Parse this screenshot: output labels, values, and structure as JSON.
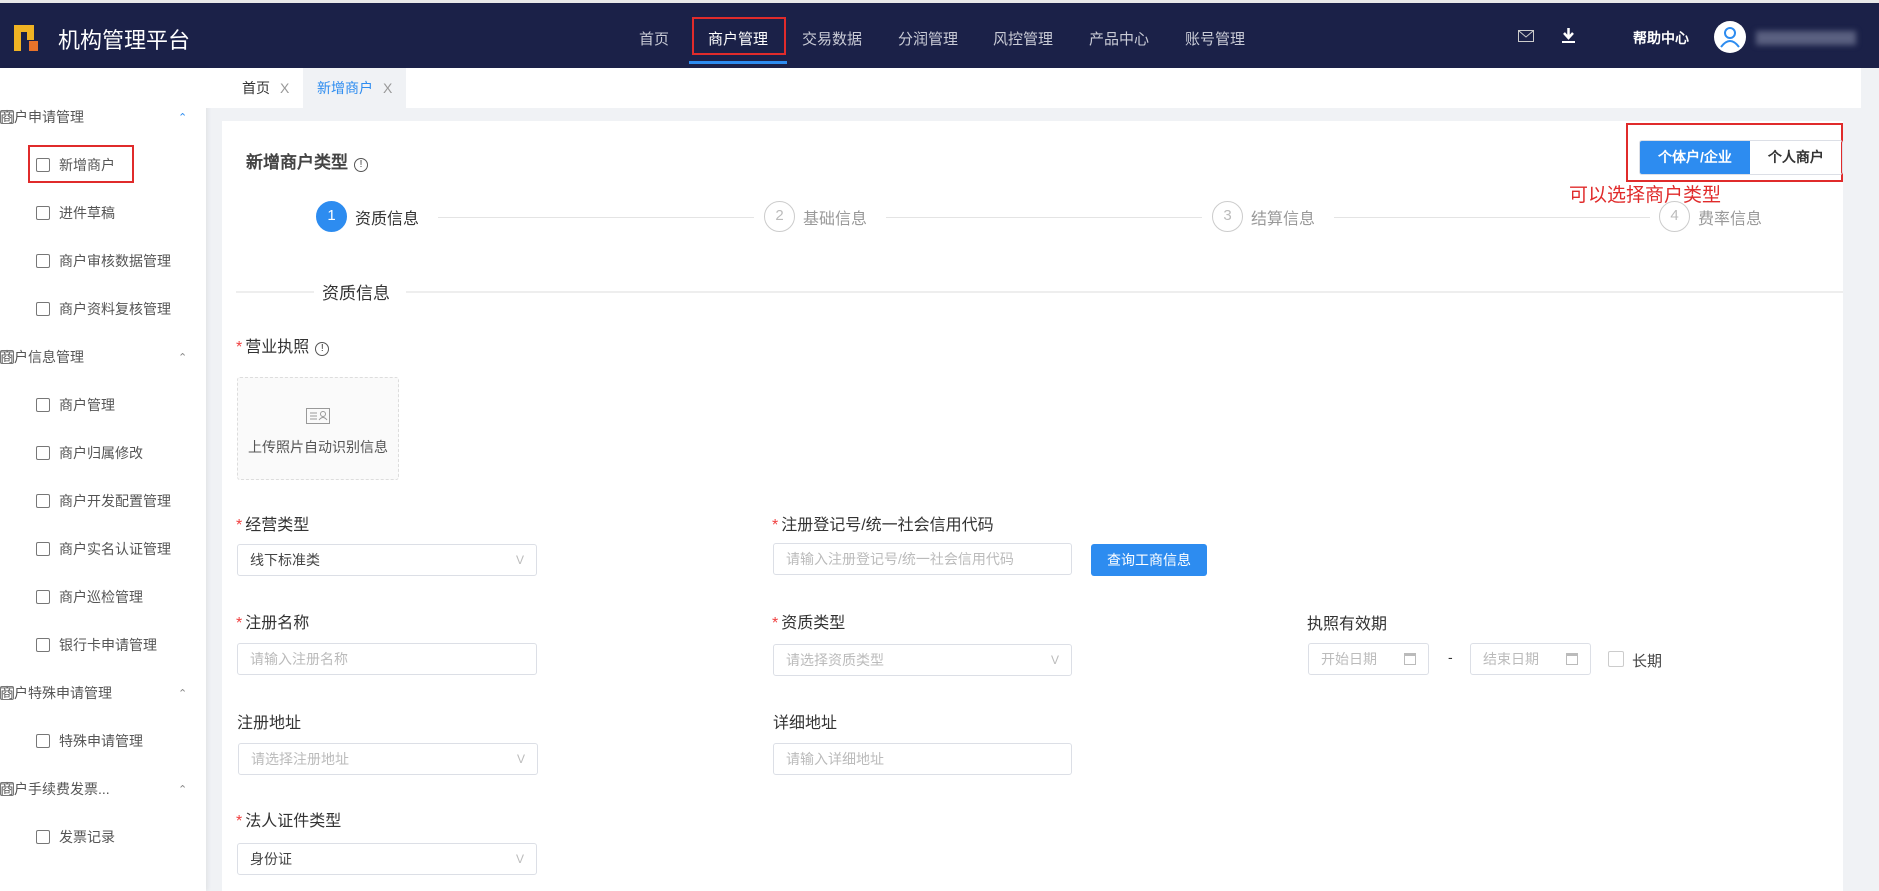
{
  "header": {
    "brand": "机构管理平台",
    "nav": [
      "首页",
      "商户管理",
      "交易数据",
      "分润管理",
      "风控管理",
      "产品中心",
      "账号管理"
    ],
    "active_nav": "商户管理",
    "help": "帮助中心"
  },
  "sidebar": {
    "items": [
      {
        "label": "商户申请管理",
        "type": "group"
      },
      {
        "label": "新增商户",
        "type": "sub"
      },
      {
        "label": "进件草稿",
        "type": "sub"
      },
      {
        "label": "商户审核数据管理",
        "type": "sub"
      },
      {
        "label": "商户资料复核管理",
        "type": "sub"
      },
      {
        "label": "商户信息管理",
        "type": "group"
      },
      {
        "label": "商户管理",
        "type": "sub"
      },
      {
        "label": "商户归属修改",
        "type": "sub"
      },
      {
        "label": "商户开发配置管理",
        "type": "sub"
      },
      {
        "label": "商户实名认证管理",
        "type": "sub"
      },
      {
        "label": "商户巡检管理",
        "type": "sub"
      },
      {
        "label": "银行卡申请管理",
        "type": "sub"
      },
      {
        "label": "商户特殊申请管理",
        "type": "group"
      },
      {
        "label": "特殊申请管理",
        "type": "sub"
      },
      {
        "label": "商户手续费发票...",
        "type": "group"
      },
      {
        "label": "发票记录",
        "type": "sub"
      }
    ]
  },
  "tabs": [
    {
      "label": "首页",
      "close": "X"
    },
    {
      "label": "新增商户",
      "close": "X"
    }
  ],
  "page": {
    "title": "新增商户类型",
    "info": "!",
    "type_options": [
      "个体户/企业",
      "个人商户"
    ],
    "selected_type": "个体户/企业",
    "annotation": "可以选择商户类型",
    "steps": [
      {
        "num": "1",
        "label": "资质信息"
      },
      {
        "num": "2",
        "label": "基础信息"
      },
      {
        "num": "3",
        "label": "结算信息"
      },
      {
        "num": "4",
        "label": "费率信息"
      }
    ],
    "section": "资质信息",
    "license_label": "营业执照",
    "upload_text": "上传照片自动识别信息",
    "fields": {
      "biz_type": {
        "label": "经营类型",
        "value": "线下标准类"
      },
      "reg_no": {
        "label": "注册登记号/统一社会信用代码",
        "placeholder": "请输入注册登记号/统一社会信用代码",
        "button": "查询工商信息"
      },
      "reg_name": {
        "label": "注册名称",
        "placeholder": "请输入注册名称"
      },
      "qual_type": {
        "label": "资质类型",
        "placeholder": "请选择资质类型"
      },
      "validity": {
        "label": "执照有效期",
        "start": "开始日期",
        "sep": "-",
        "end": "结束日期",
        "long_term": "长期"
      },
      "reg_addr": {
        "label": "注册地址",
        "placeholder": "请选择注册地址"
      },
      "detail_addr": {
        "label": "详细地址",
        "placeholder": "请输入详细地址"
      },
      "legal_id_type": {
        "label": "法人证件类型",
        "value": "身份证"
      }
    }
  },
  "req": "*",
  "chevron": "V"
}
